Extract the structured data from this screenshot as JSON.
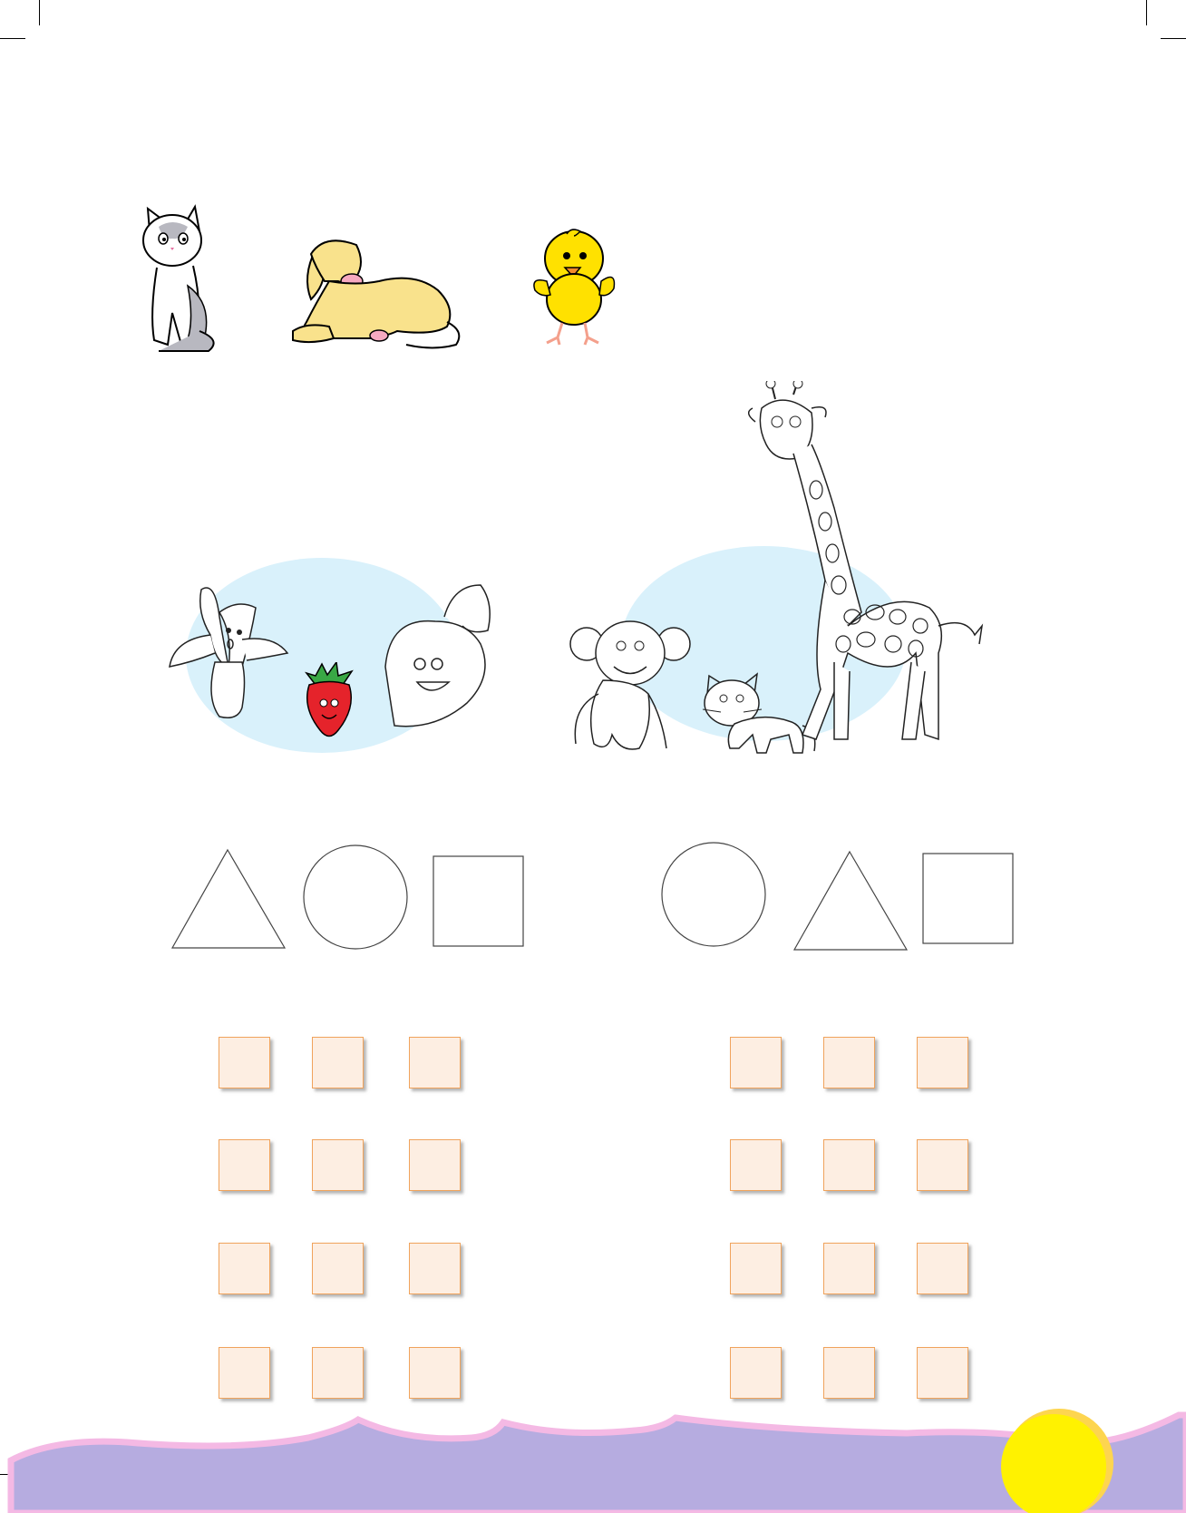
{
  "theme": {
    "oval_color": "#d9f1fb",
    "box_fill": "#fdeee2",
    "box_border": "#f0a35c",
    "wave_color": "#b6ace0",
    "wave_edge": "#f4b9e4",
    "sun_color": "#fff200",
    "sun_edge": "#fdd54f"
  },
  "row1_animals": [
    {
      "icon": "cat-icon"
    },
    {
      "icon": "dog-icon"
    },
    {
      "icon": "chick-icon"
    }
  ],
  "group_left": {
    "items": [
      "banana-icon",
      "strawberry-icon",
      "mango-icon"
    ]
  },
  "group_right": {
    "items": [
      "monkey-icon",
      "kitten-icon",
      "giraffe-icon"
    ]
  },
  "shapes_left": [
    "triangle",
    "circle",
    "square"
  ],
  "shapes_right": [
    "circle",
    "triangle",
    "square"
  ],
  "answer_grid": {
    "rows": 4,
    "columns_per_group": 3,
    "groups": 2
  }
}
